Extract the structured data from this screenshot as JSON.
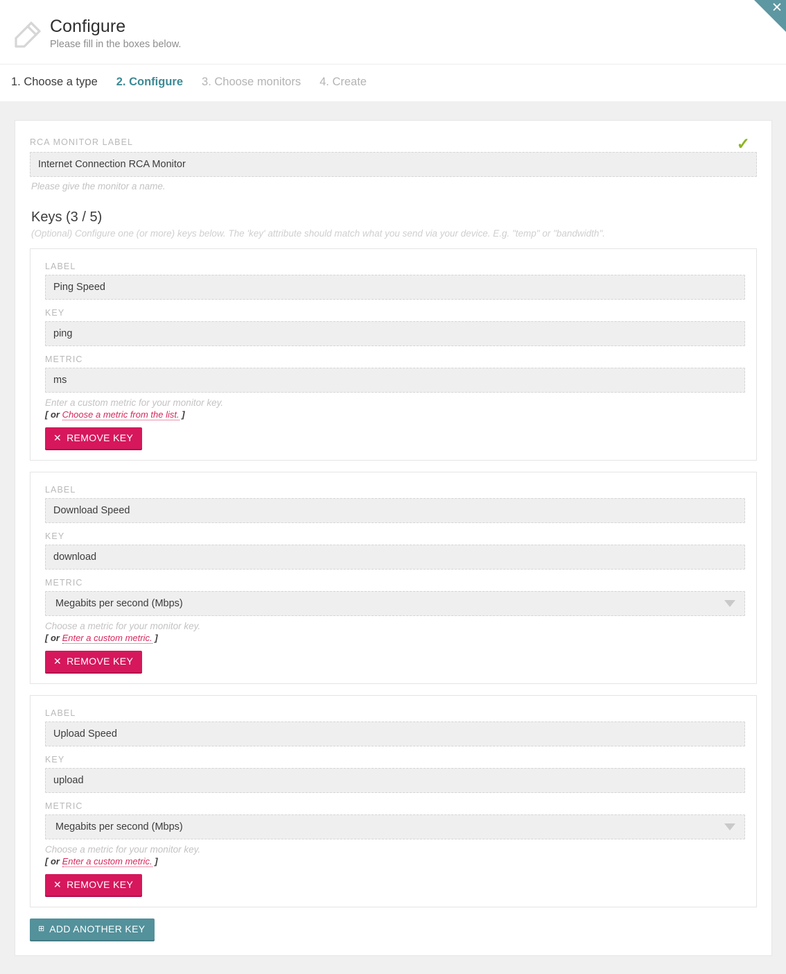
{
  "header": {
    "icon": "pencil-icon",
    "title": "Configure",
    "subtitle": "Please fill in the boxes below.",
    "close_label": "✕"
  },
  "steps": [
    {
      "label": "1. Choose a type",
      "state": "done"
    },
    {
      "label": "2. Configure",
      "state": "active"
    },
    {
      "label": "3. Choose monitors",
      "state": "todo"
    },
    {
      "label": "4. Create",
      "state": "todo"
    }
  ],
  "monitor_label": {
    "field_label": "RCA MONITOR LABEL",
    "value": "Internet Connection RCA Monitor",
    "placeholder": "",
    "hint": "Please give the monitor a name.",
    "valid_icon": "✓"
  },
  "keys_section": {
    "heading": "Keys (3 / 5)",
    "description": "(Optional) Configure one (or more) keys below. The 'key' attribute should match what you send via your device. E.g. \"temp\" or \"bandwidth\".",
    "label_field_label": "LABEL",
    "key_field_label": "KEY",
    "metric_field_label": "METRIC"
  },
  "keys": [
    {
      "label_value": "Ping Speed",
      "key_value": "ping",
      "metric_type": "text",
      "metric_value": "ms",
      "metric_hint": "Enter a custom metric for your monitor key.",
      "alt_prefix": "[ or ",
      "alt_link": "Choose a metric from the list.",
      "alt_suffix": " ]",
      "remove_label": "REMOVE KEY",
      "remove_glyph": "✕"
    },
    {
      "label_value": "Download Speed",
      "key_value": "download",
      "metric_type": "select",
      "metric_value": "Megabits per second (Mbps)",
      "metric_hint": "Choose a metric for your monitor key.",
      "alt_prefix": "[ or ",
      "alt_link": "Enter a custom metric.",
      "alt_suffix": " ]",
      "remove_label": "REMOVE KEY",
      "remove_glyph": "✕"
    },
    {
      "label_value": "Upload Speed",
      "key_value": "upload",
      "metric_type": "select",
      "metric_value": "Megabits per second (Mbps)",
      "metric_hint": "Choose a metric for your monitor key.",
      "alt_prefix": "[ or ",
      "alt_link": "Enter a custom metric.",
      "alt_suffix": " ]",
      "remove_label": "REMOVE KEY",
      "remove_glyph": "✕"
    }
  ],
  "add_key_button": {
    "label": "ADD ANOTHER KEY",
    "glyph": "⊞"
  },
  "colors": {
    "accent_teal": "#53919b",
    "step_active": "#3d8a95",
    "remove_pink": "#d6175c",
    "link_pink": "#d6285c",
    "valid_green": "#8cb520",
    "page_bg": "#f0f0f0"
  }
}
